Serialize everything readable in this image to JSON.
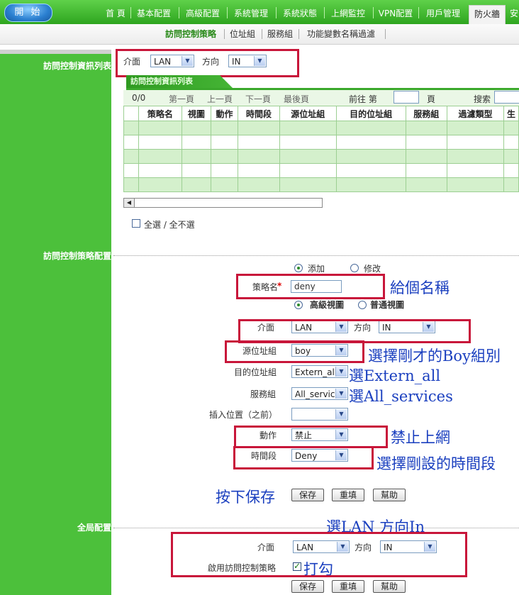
{
  "topnav": {
    "start": "開 始",
    "items": [
      "首 頁",
      "基本配置",
      "高級配置",
      "系統管理",
      "系統狀態",
      "上網監控",
      "VPN配置",
      "用戶管理",
      "防火牆",
      "安"
    ]
  },
  "subnav": [
    "訪問控制策略",
    "位址組",
    "服務組",
    "功能變數名稱過濾"
  ],
  "left": {
    "list_header": "訪問控制資訊列表",
    "config_header": "訪問控制策略配置",
    "global_header": "全局配置"
  },
  "filter": {
    "iface_label": "介面",
    "iface_value": "LAN",
    "dir_label": "方向",
    "dir_value": "IN"
  },
  "table": {
    "tab_title": "訪問控制資訊列表",
    "count": "0/0",
    "first": "第一頁",
    "prev": "上一頁",
    "next": "下一頁",
    "last": "最後頁",
    "goto_label": "前往 第",
    "page_label": "頁",
    "search_label": "搜索",
    "columns": [
      "",
      "策略名",
      "視圖",
      "動作",
      "時間段",
      "源位址組",
      "目的位址組",
      "服務組",
      "過濾類型",
      "生"
    ]
  },
  "select_all": "全選 / 全不選",
  "form": {
    "add_label": "添加",
    "modify_label": "修改",
    "name_label": "策略名",
    "required_mark": "*",
    "name_value": "deny",
    "adv_view": "高級視圖",
    "normal_view": "普通視圖",
    "iface_label": "介面",
    "iface_value": "LAN",
    "dir_label": "方向",
    "dir_value": "IN",
    "src_label": "源位址組",
    "src_value": "boy",
    "dst_label": "目的位址組",
    "dst_value": "Extern_all",
    "svc_label": "服務組",
    "svc_value": "All_services",
    "pos_label": "插入位置（之前）",
    "pos_value": "",
    "action_label": "動作",
    "action_value": "禁止",
    "time_label": "時間段",
    "time_value": "Deny",
    "save": "保存",
    "reset": "重填",
    "help": "幫助"
  },
  "global": {
    "iface_label": "介面",
    "iface_value": "LAN",
    "dir_label": "方向",
    "dir_value": "IN",
    "enable_label": "啟用訪問控制策略",
    "enable_checked": true,
    "save": "保存",
    "reset": "重填",
    "help": "幫助"
  },
  "annotations": {
    "name": "給個名稱",
    "src": "選擇剛才的Boy組別",
    "dst": "選Extern_all",
    "svc": "選All_services",
    "action": "禁止上網",
    "time": "選擇剛設的時間段",
    "save": "按下保存",
    "global": "選LAN 方向In",
    "check": "打勾"
  },
  "colors": {
    "brand_green": "#4cc03b",
    "annotation_blue": "#1a3fbf",
    "highlight_red": "#c8163a"
  }
}
